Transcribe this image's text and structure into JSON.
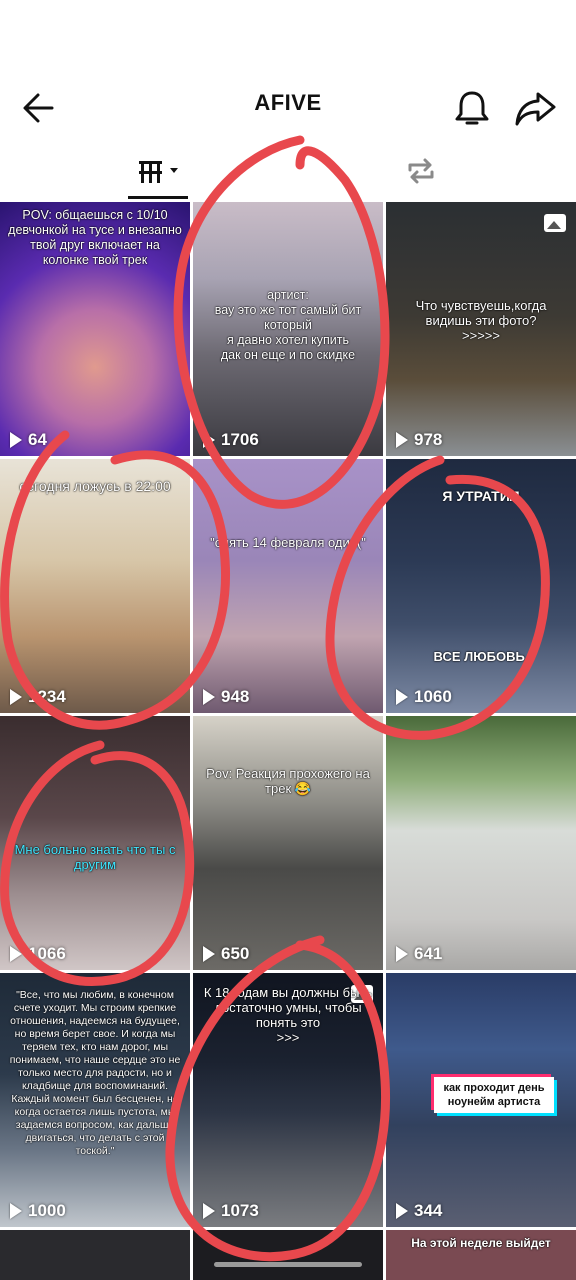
{
  "header": {
    "title": "AFIVE"
  },
  "icons": {
    "back": "arrow-left-icon",
    "bell": "bell-icon",
    "share": "share-arrow-icon",
    "videos_tab": "grid-columns-icon",
    "reposts_tab": "repost-icon"
  },
  "colors": {
    "annotation_red": "#e8484d"
  },
  "tiles": [
    {
      "caption": "POV: общаешься с 10/10 девчонкой на тусе и внезапно твой друг включает на колонке твой трек",
      "views": "64"
    },
    {
      "caption": "артист:\nвау это же тот самый бит который\nя давно хотел купить\nдак он еще и по скидке",
      "views": "1706"
    },
    {
      "caption": "Что чувствуешь,когда видишь эти фото?\n>>>>>",
      "views": "978"
    },
    {
      "caption": "сегодня ложусь в 22:00",
      "views": "1234"
    },
    {
      "caption": "\"опять 14 февраля один(\"",
      "views": "948"
    },
    {
      "caption": "Я УТРАТИЛ",
      "caption2": "ВСЕ ЛЮБОВЬ,",
      "views": "1060"
    },
    {
      "caption": "Мне больно знать что ты с другим",
      "views": "1066"
    },
    {
      "caption": "Pov: Реакция прохожего на трек 😂",
      "views": "650"
    },
    {
      "caption": "",
      "views": "641"
    },
    {
      "caption": "\"Все, что мы любим, в конечном счете уходит. Мы строим крепкие отношения, надеемся на будущее, но время берет свое. И когда мы теряем тех, кто нам дорог, мы понимаем, что наше сердце это не только место для радости, но и кладбище для воспоминаний. Каждый момент был бесценен, но когда остается лишь пустота, мы задаемся вопросом, как дальше двигаться, что делать с этой тоской.\"",
      "views": "1000"
    },
    {
      "caption": "К 18 годам вы должны быть достаточно умны, чтобы понять это\n>>>",
      "views": "1073"
    },
    {
      "caption": "как проходит день ноунейм артиста",
      "views": "344"
    }
  ],
  "partial_row": {
    "caption": "На этой неделе выйдет"
  }
}
